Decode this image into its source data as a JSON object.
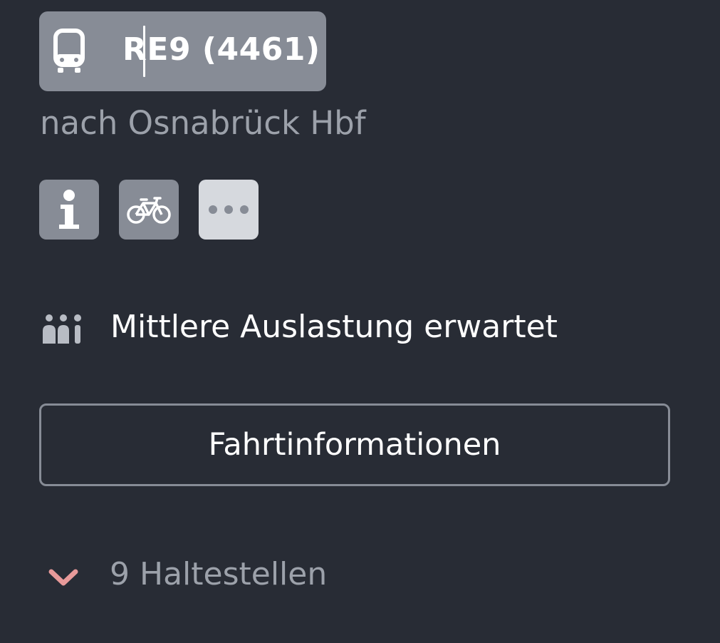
{
  "train": {
    "label": "RE9 (4461)",
    "icon": "train-icon",
    "badge_color": "#878c96"
  },
  "direction": "nach Osnabrück Hbf",
  "attribute_buttons": [
    {
      "icon": "info-icon"
    },
    {
      "icon": "bicycle-icon"
    },
    {
      "icon": "more-icon"
    }
  ],
  "occupancy": {
    "icon": "occupancy-icon",
    "text": "Mittlere Auslastung erwartet"
  },
  "details_button": {
    "label": "Fahrtinformationen"
  },
  "stops": {
    "icon": "chevron-down-icon",
    "label": "9 Haltestellen",
    "accent_color": "#e89a9a"
  },
  "colors": {
    "background": "#282c35",
    "muted_text": "#9ca1aa",
    "badge": "#878c96",
    "more_button": "#d6d9de"
  }
}
